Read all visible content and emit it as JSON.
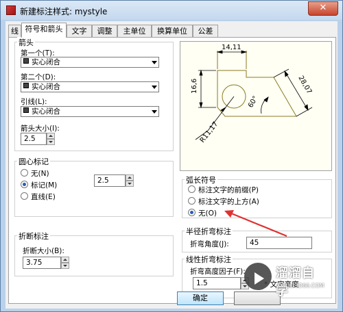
{
  "window": {
    "title": "新建标注样式: mystyle",
    "close": "✕"
  },
  "tabs": [
    {
      "label": "线"
    },
    {
      "label": "符号和箭头"
    },
    {
      "label": "文字"
    },
    {
      "label": "调整"
    },
    {
      "label": "主单位"
    },
    {
      "label": "换算单位"
    },
    {
      "label": "公差"
    }
  ],
  "arrows": {
    "group_label": "箭头",
    "first_label": "第一个(T):",
    "first_value": "实心闭合",
    "second_label": "第二个(D):",
    "second_value": "实心闭合",
    "leader_label": "引线(L):",
    "leader_value": "实心闭合",
    "size_label": "箭头大小(I):",
    "size_value": "2.5"
  },
  "center_mark": {
    "group_label": "圆心标记",
    "options": [
      {
        "label": "无(N)",
        "selected": false
      },
      {
        "label": "标记(M)",
        "selected": true
      },
      {
        "label": "直线(E)",
        "selected": false
      }
    ],
    "size_value": "2.5"
  },
  "break": {
    "group_label": "折断标注",
    "size_label": "折断大小(B):",
    "size_value": "3.75"
  },
  "preview": {
    "dim_top": "14,11",
    "dim_left": "16,6",
    "dim_diag": "28,07",
    "dim_angle": "60°",
    "dim_radius": "R11,17"
  },
  "arc_symbol": {
    "group_label": "弧长符号",
    "options": [
      {
        "label": "标注文字的前缀(P)",
        "selected": false
      },
      {
        "label": "标注文字的上方(A)",
        "selected": false
      },
      {
        "label": "无(O)",
        "selected": true
      }
    ]
  },
  "radius_jog": {
    "group_label": "半径折弯标注",
    "angle_label": "折弯角度(J):",
    "angle_value": "45"
  },
  "linear_jog": {
    "group_label": "线性折弯标注",
    "factor_label": "折弯高度因子(F):",
    "factor_value": "1.5",
    "suffix": "* 文字高度"
  },
  "buttons": {
    "ok": "确定"
  },
  "watermark": {
    "name": "溜溜自学",
    "url": "ZIXUE.3D66.COM"
  },
  "colors": {
    "annotation_arrow": "#e03030",
    "preview_lines": "#8a7a20",
    "preview_bg": "#fffff4"
  }
}
